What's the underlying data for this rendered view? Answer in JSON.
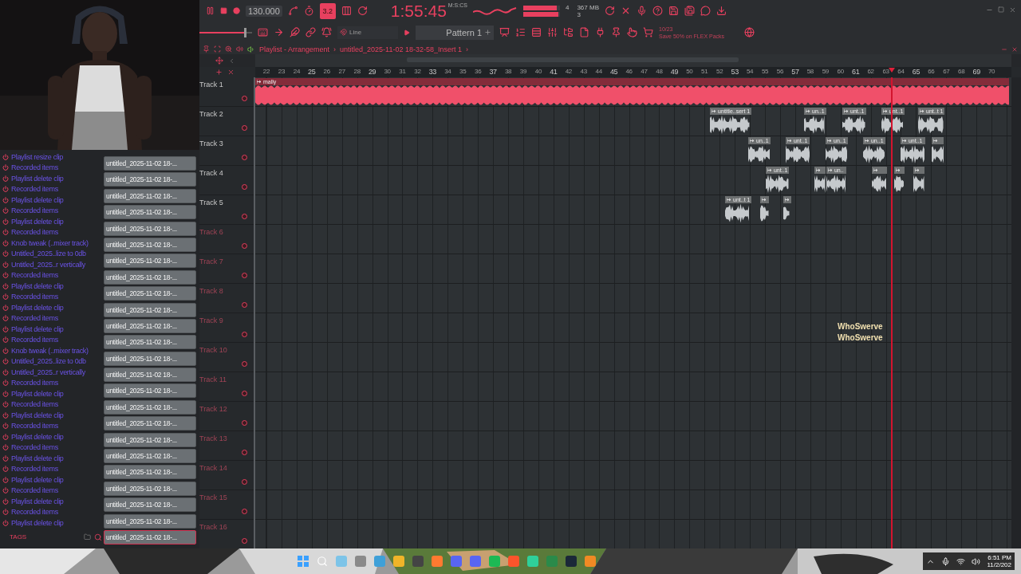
{
  "toolbar": {
    "playing": true,
    "tempo": "130.000",
    "step_button": {
      "label": "3.2",
      "on": true
    },
    "time": {
      "value": "1:55:45",
      "unit": "M:S:CS"
    },
    "meters": [
      {
        "level": 0.92
      },
      {
        "level": 0.95
      }
    ],
    "stats": {
      "polyphony": "4",
      "memory": "367 MB",
      "cores": "3"
    },
    "master_volume": {
      "level": 0.86
    },
    "snap": "Line",
    "pattern": "Pattern 1",
    "news": {
      "count": "10/23",
      "text": "Save 50% on FLEX Packs"
    }
  },
  "history": [
    {
      "text": "Playlist resize clip"
    },
    {
      "text": "Recorded items"
    },
    {
      "text": "Playlist delete clip"
    },
    {
      "text": "Recorded items"
    },
    {
      "text": "Playlist delete clip"
    },
    {
      "text": "Recorded items"
    },
    {
      "text": "Playlist delete clip"
    },
    {
      "text": "Recorded items"
    },
    {
      "text": "Knob tweak (..mixer track)"
    },
    {
      "text": "Untitled_2025..lize to 0db"
    },
    {
      "text": "Untitled_2025..r vertically"
    },
    {
      "text": "Recorded items"
    },
    {
      "text": "Playlist delete clip"
    },
    {
      "text": "Recorded items"
    },
    {
      "text": "Playlist delete clip"
    },
    {
      "text": "Recorded items"
    },
    {
      "text": "Playlist delete clip"
    },
    {
      "text": "Recorded items"
    },
    {
      "text": "Knob tweak (..mixer track)"
    },
    {
      "text": "Untitled_2025..lize to 0db"
    },
    {
      "text": "Untitled_2025..r vertically"
    },
    {
      "text": "Recorded items"
    },
    {
      "text": "Playlist delete clip"
    },
    {
      "text": "Recorded items"
    },
    {
      "text": "Playlist delete clip"
    },
    {
      "text": "Recorded items"
    },
    {
      "text": "Playlist delete clip"
    },
    {
      "text": "Recorded items"
    },
    {
      "text": "Playlist delete clip"
    },
    {
      "text": "Recorded items"
    },
    {
      "text": "Playlist delete clip"
    },
    {
      "text": "Recorded items"
    },
    {
      "text": "Playlist delete clip"
    },
    {
      "text": "Recorded items"
    },
    {
      "text": "Playlist delete clip"
    }
  ],
  "clip_list": [
    {
      "label": "untitled_2025-11-02 18-...",
      "selected": false
    },
    {
      "label": "untitled_2025-11-02 18-...",
      "selected": false
    },
    {
      "label": "untitled_2025-11-02 18-...",
      "selected": false
    },
    {
      "label": "untitled_2025-11-02 18-...",
      "selected": false
    },
    {
      "label": "untitled_2025-11-02 18-...",
      "selected": false
    },
    {
      "label": "untitled_2025-11-02 18-...",
      "selected": false
    },
    {
      "label": "untitled_2025-11-02 18-...",
      "selected": false
    },
    {
      "label": "untitled_2025-11-02 18-...",
      "selected": false
    },
    {
      "label": "untitled_2025-11-02 18-...",
      "selected": false
    },
    {
      "label": "untitled_2025-11-02 18-...",
      "selected": false
    },
    {
      "label": "untitled_2025-11-02 18-...",
      "selected": false
    },
    {
      "label": "untitled_2025-11-02 18-...",
      "selected": false
    },
    {
      "label": "untitled_2025-11-02 18-...",
      "selected": false
    },
    {
      "label": "untitled_2025-11-02 18-...",
      "selected": false
    },
    {
      "label": "untitled_2025-11-02 18-...",
      "selected": false
    },
    {
      "label": "untitled_2025-11-02 18-...",
      "selected": false
    },
    {
      "label": "untitled_2025-11-02 18-...",
      "selected": false
    },
    {
      "label": "untitled_2025-11-02 18-...",
      "selected": false
    },
    {
      "label": "untitled_2025-11-02 18-...",
      "selected": false
    },
    {
      "label": "untitled_2025-11-02 18-...",
      "selected": false
    },
    {
      "label": "untitled_2025-11-02 18-...",
      "selected": false
    },
    {
      "label": "untitled_2025-11-02 18-...",
      "selected": false
    },
    {
      "label": "untitled_2025-11-02 18-...",
      "selected": false
    },
    {
      "label": "untitled_2025-11-02 18-...",
      "selected": true
    }
  ],
  "sidebar_footer": {
    "tags": "TAGS"
  },
  "playlist": {
    "title": "Playlist - Arrangement",
    "separator": "›",
    "path": "untitled_2025-11-02 18-32-58_Insert 1",
    "path_end": "›",
    "ruler": [
      "22",
      "23",
      "24",
      "25",
      "26",
      "27",
      "28",
      "29",
      "30",
      "31",
      "32",
      "33",
      "34",
      "35",
      "36",
      "37",
      "38",
      "39",
      "40",
      "41",
      "42",
      "43",
      "44",
      "45",
      "46",
      "47",
      "48",
      "49",
      "50",
      "51",
      "52",
      "53",
      "54",
      "55",
      "56",
      "57",
      "58",
      "59",
      "60",
      "61",
      "62",
      "63",
      "64",
      "65",
      "66",
      "67",
      "68",
      "69",
      "70"
    ],
    "tracks": [
      {
        "name": "Track 1",
        "empty": false,
        "clips": [
          {
            "label": "mally",
            "color": "#f0506a"
          }
        ]
      },
      {
        "name": "Track 2",
        "empty": false,
        "clips": [
          {
            "label": "untitle..sert 1",
            "color": "#c5c9cc"
          },
          {
            "label": "un..1",
            "color": "#c5c9cc"
          },
          {
            "label": "unt..1",
            "color": "#c5c9cc"
          },
          {
            "label": "unt..1",
            "color": "#c5c9cc"
          },
          {
            "label": "unt..t 1",
            "color": "#c5c9cc"
          }
        ]
      },
      {
        "name": "Track 3",
        "empty": false,
        "clips": [
          {
            "label": "un..1",
            "color": "#c5c9cc"
          },
          {
            "label": "unt..1",
            "color": "#c5c9cc"
          },
          {
            "label": "un..1",
            "color": "#c5c9cc"
          },
          {
            "label": "un..1",
            "color": "#c5c9cc"
          },
          {
            "label": "unt..1",
            "color": "#c5c9cc"
          },
          {
            "color": "#c5c9cc"
          }
        ]
      },
      {
        "name": "Track 4",
        "empty": false,
        "clips": [
          {
            "label": "unt..1",
            "color": "#c5c9cc"
          },
          {
            "color": "#c5c9cc"
          },
          {
            "label": "un..",
            "color": "#c5c9cc"
          },
          {
            "color": "#c5c9cc"
          },
          {
            "color": "#c5c9cc"
          },
          {
            "color": "#c5c9cc"
          }
        ]
      },
      {
        "name": "Track 5",
        "empty": false,
        "clips": [
          {
            "label": "unt..t 1",
            "color": "#c5c9cc"
          },
          {
            "color": "#c5c9cc"
          },
          {
            "color": "#c5c9cc"
          }
        ]
      },
      {
        "name": "Track 6",
        "empty": true
      },
      {
        "name": "Track 7",
        "empty": true
      },
      {
        "name": "Track 8",
        "empty": true
      },
      {
        "name": "Track 9",
        "empty": true
      },
      {
        "name": "Track 10",
        "empty": true
      },
      {
        "name": "Track 11",
        "empty": true
      },
      {
        "name": "Track 12",
        "empty": true
      },
      {
        "name": "Track 13",
        "empty": true
      },
      {
        "name": "Track 14",
        "empty": true
      },
      {
        "name": "Track 15",
        "empty": true
      },
      {
        "name": "Track 16",
        "empty": true
      }
    ],
    "alerts": [
      {
        "text": "WhoSwerve"
      },
      {
        "text": "WhoSwerve"
      }
    ]
  },
  "taskbar": {
    "time": "6:51 PM",
    "date": "11/2/202"
  }
}
